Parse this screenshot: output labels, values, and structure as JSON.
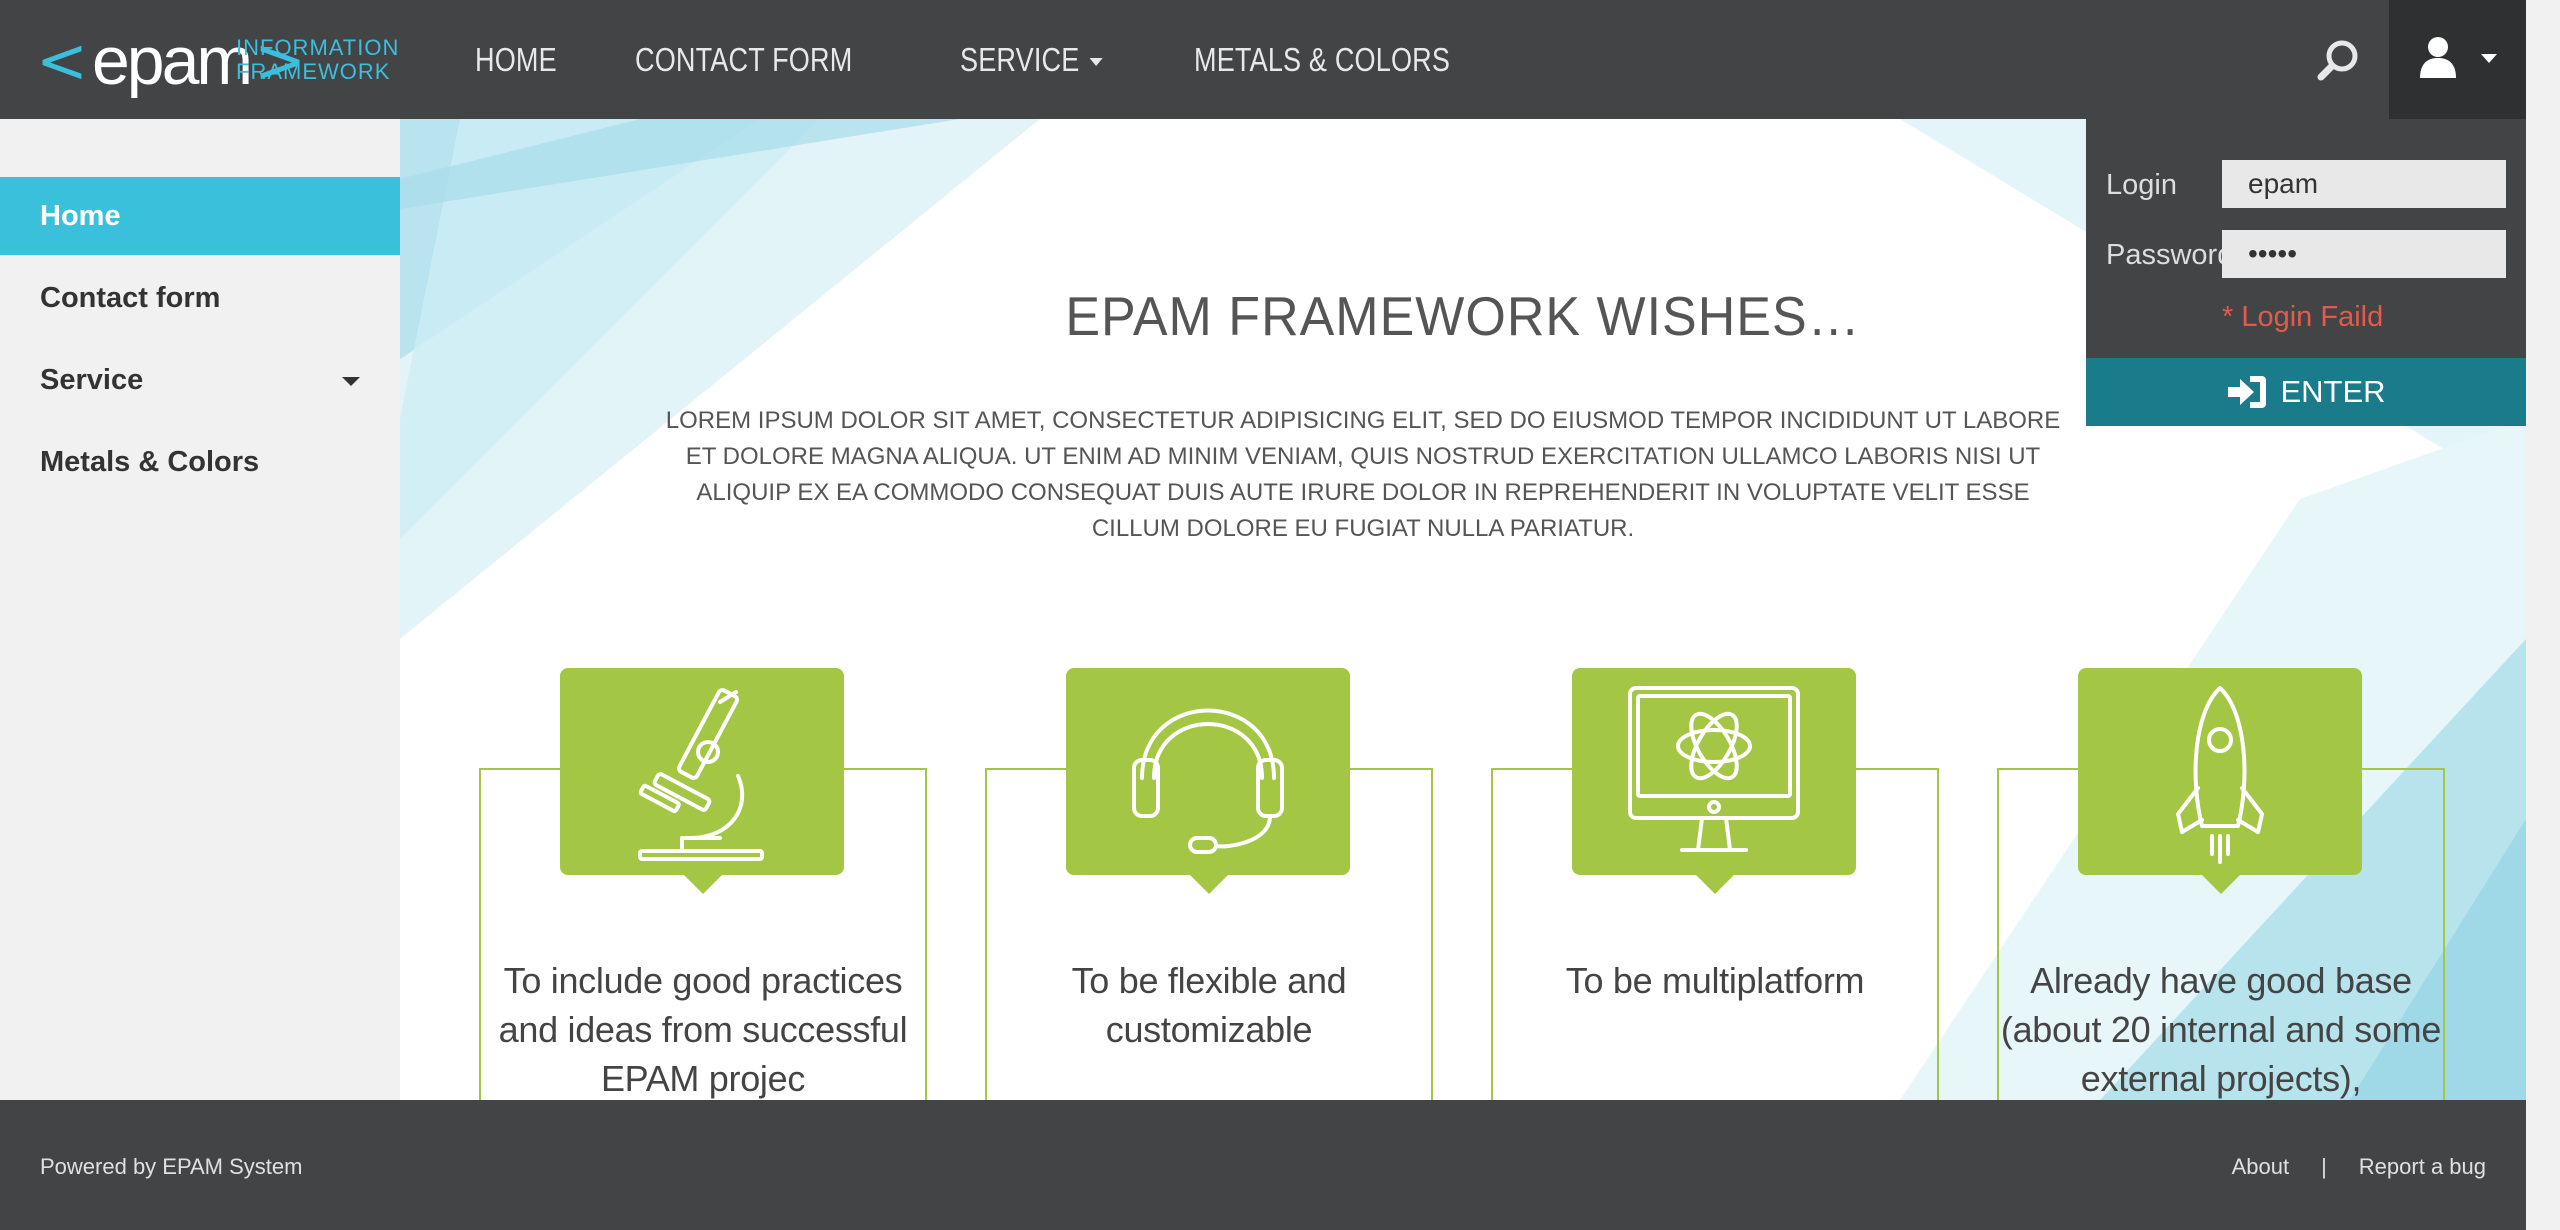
{
  "header": {
    "logo_word": "epam",
    "logo_sub_line1": "INFORMATION",
    "logo_sub_line2": "FRAMEWORK",
    "nav": [
      {
        "label": "Home"
      },
      {
        "label": "Contact form"
      },
      {
        "label": "Service",
        "has_dropdown": true
      },
      {
        "label": "Metals & Colors"
      }
    ],
    "search_icon": "search-icon",
    "user_icon": "user-icon"
  },
  "sidebar": {
    "items": [
      {
        "label": "Home",
        "active": true
      },
      {
        "label": "Contact form"
      },
      {
        "label": "Service",
        "has_dropdown": true
      },
      {
        "label": "Metals & Colors"
      }
    ]
  },
  "main": {
    "title": "EPAM FRAMEWORK WISHES…",
    "text": "LOREM IPSUM DOLOR SIT AMET, CONSECTETUR ADIPISICING ELIT, SED DO EIUSMOD TEMPOR INCIDIDUNT UT LABORE ET DOLORE MAGNA ALIQUA. UT ENIM AD MINIM VENIAM, QUIS NOSTRUD EXERCITATION ULLAMCO LABORIS NISI UT ALIQUIP EX EA COMMODO CONSEQUAT DUIS AUTE IRURE DOLOR IN REPREHENDERIT IN VOLUPTATE VELIT ESSE CILLUM DOLORE EU FUGIAT NULLA PARIATUR.",
    "benefits": [
      {
        "icon": "microscope-icon",
        "text": "To include good practices and ideas from successful EPAM projec"
      },
      {
        "icon": "headset-icon",
        "text": "To be flexible and customizable"
      },
      {
        "icon": "monitor-atom-icon",
        "text": "To be multiplatform"
      },
      {
        "icon": "rocket-icon",
        "text": "Already have good base (about 20 internal and some external projects),"
      }
    ],
    "accent_color": "#a3c644"
  },
  "login": {
    "login_label": "Login",
    "login_value": "epam",
    "password_label": "Password",
    "password_value": "•••••",
    "error": "* Login Faild",
    "enter_label": "ENTER",
    "enter_icon": "sign-in-icon"
  },
  "footer": {
    "powered": "Powered by EPAM System",
    "about": "About",
    "separator": "|",
    "report": "Report a bug"
  },
  "colors": {
    "header_bg": "#434446",
    "sidebar_active": "#3bc0db",
    "enter_bg": "#1a7b8a",
    "error": "#e25b4c"
  }
}
